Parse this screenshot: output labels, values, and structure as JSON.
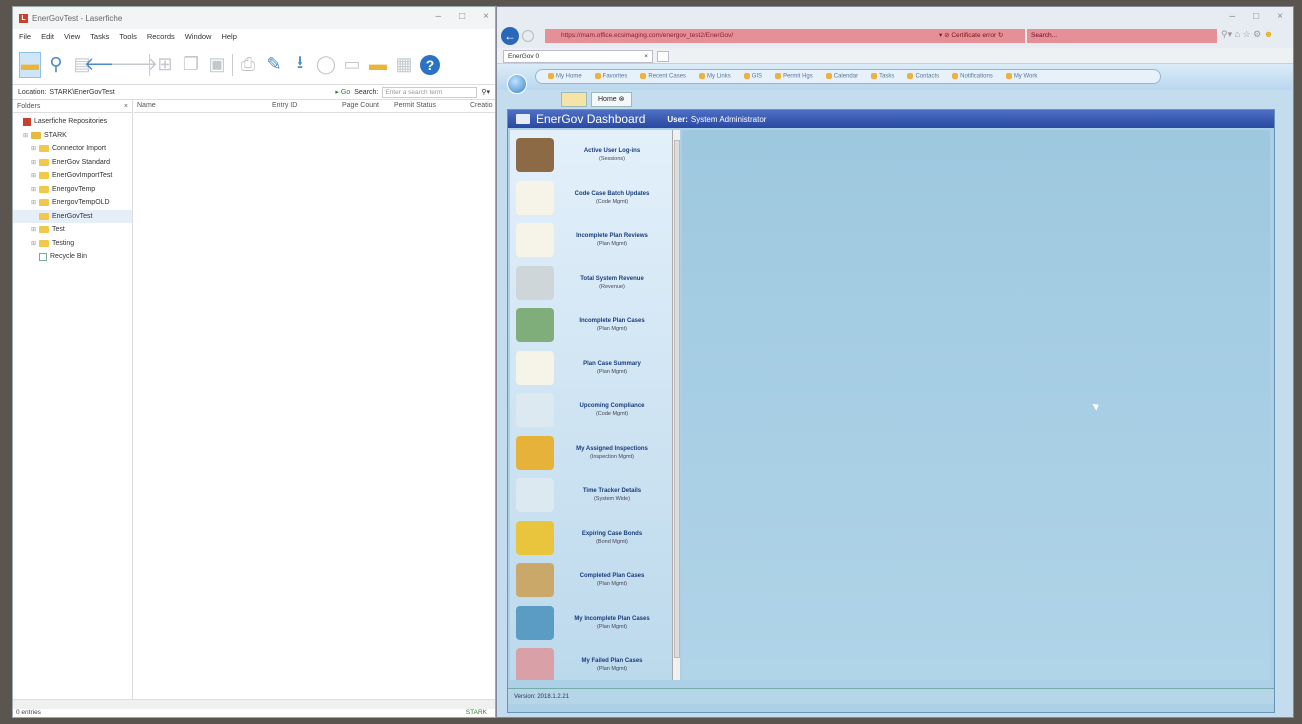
{
  "laserfiche": {
    "title": "EnerGovTest - Laserfiche",
    "menu": [
      "File",
      "Edit",
      "View",
      "Tasks",
      "Tools",
      "Records",
      "Window",
      "Help"
    ],
    "location_label": "Location:",
    "location_value": "STARK\\EnerGovTest",
    "go_label": "Go",
    "search_label": "Search:",
    "search_placeholder": "Enter a search term",
    "folders_header": "Folders",
    "columns": [
      "Name",
      "Entry ID",
      "Page Count",
      "Permit Status",
      "Creatio"
    ],
    "tree": [
      {
        "label": "Laserfiche Repositories",
        "icon": "repository-icon",
        "indent": 0
      },
      {
        "label": "STARK",
        "icon": "folder-open-icon",
        "indent": 1
      },
      {
        "label": "Connector Import",
        "icon": "folder-icon",
        "indent": 2
      },
      {
        "label": "EnerGov Standard",
        "icon": "folder-icon",
        "indent": 2
      },
      {
        "label": "EnerGovImportTest",
        "icon": "folder-icon",
        "indent": 2
      },
      {
        "label": "EnergovTemp",
        "icon": "folder-icon",
        "indent": 2
      },
      {
        "label": "EnergovTempOLD",
        "icon": "folder-icon",
        "indent": 2
      },
      {
        "label": "EnerGovTest",
        "icon": "folder-icon",
        "indent": 2
      },
      {
        "label": "Test",
        "icon": "folder-icon",
        "indent": 2
      },
      {
        "label": "Testing",
        "icon": "folder-icon",
        "indent": 2
      },
      {
        "label": "Recycle Bin",
        "icon": "recycle-bin-icon",
        "indent": 2
      }
    ],
    "status_entries": "0 entries",
    "status_repo": "STARK"
  },
  "browser": {
    "url": "https://mam.office.ecsimaging.com/energov_test2/EnerGov/",
    "cert_error": "Certificate error",
    "search_placeholder": "Search...",
    "tab_label": "EnerGov 0"
  },
  "energov": {
    "nav": [
      "My Home",
      "Favorites",
      "Recent Cases",
      "My Links",
      "GIS",
      "Permit Hgs",
      "Calendar",
      "Tasks",
      "Contacts",
      "Notifications",
      "My Work"
    ],
    "home_tab": "Home",
    "header_title": "EnerGov Dashboard",
    "user_label": "User:",
    "user_value": "System Administrator",
    "version": "Version: 2018.1.2.21",
    "items": [
      {
        "title": "Active User Log-ins",
        "sub": "(Sessions)",
        "icon": "users-icon",
        "color": "#8b6a45"
      },
      {
        "title": "Code Case Batch Updates",
        "sub": "(Code Mgmt)",
        "icon": "chart-report-icon",
        "color": "#f6f3e8"
      },
      {
        "title": "Incomplete Plan Reviews",
        "sub": "(Plan Mgmt)",
        "icon": "chart-report-icon",
        "color": "#f6f3e8"
      },
      {
        "title": "Total System Revenue",
        "sub": "(Revenue)",
        "icon": "cash-register-icon",
        "color": "#cfd6da"
      },
      {
        "title": "Incomplete Plan Cases",
        "sub": "(Plan Mgmt)",
        "icon": "binders-icon",
        "color": "#7fae7a"
      },
      {
        "title": "Plan Case Summary",
        "sub": "(Plan Mgmt)",
        "icon": "chart-report-icon",
        "color": "#f6f3e8"
      },
      {
        "title": "Upcoming Compliance",
        "sub": "(Code Mgmt)",
        "icon": "clock-icon",
        "color": "#dce9f1"
      },
      {
        "title": "My Assigned Inspections",
        "sub": "(Inspection Mgmt)",
        "icon": "inspector-icon",
        "color": "#e7b23a"
      },
      {
        "title": "Time Tracker Details",
        "sub": "(System Wide)",
        "icon": "clock-icon",
        "color": "#dce9f1"
      },
      {
        "title": "Expiring Case Bonds",
        "sub": "(Bond Mgmt)",
        "icon": "seal-icon",
        "color": "#e8c53d"
      },
      {
        "title": "Completed Plan Cases",
        "sub": "(Plan Mgmt)",
        "icon": "toolbox-icon",
        "color": "#c9a86a"
      },
      {
        "title": "My Incomplete Plan Cases",
        "sub": "(Plan Mgmt)",
        "icon": "globe-icon",
        "color": "#5b9cc4"
      },
      {
        "title": "My Failed Plan Cases",
        "sub": "(Plan Mgmt)",
        "icon": "failed-doc-icon",
        "color": "#d9a0a8"
      }
    ]
  }
}
